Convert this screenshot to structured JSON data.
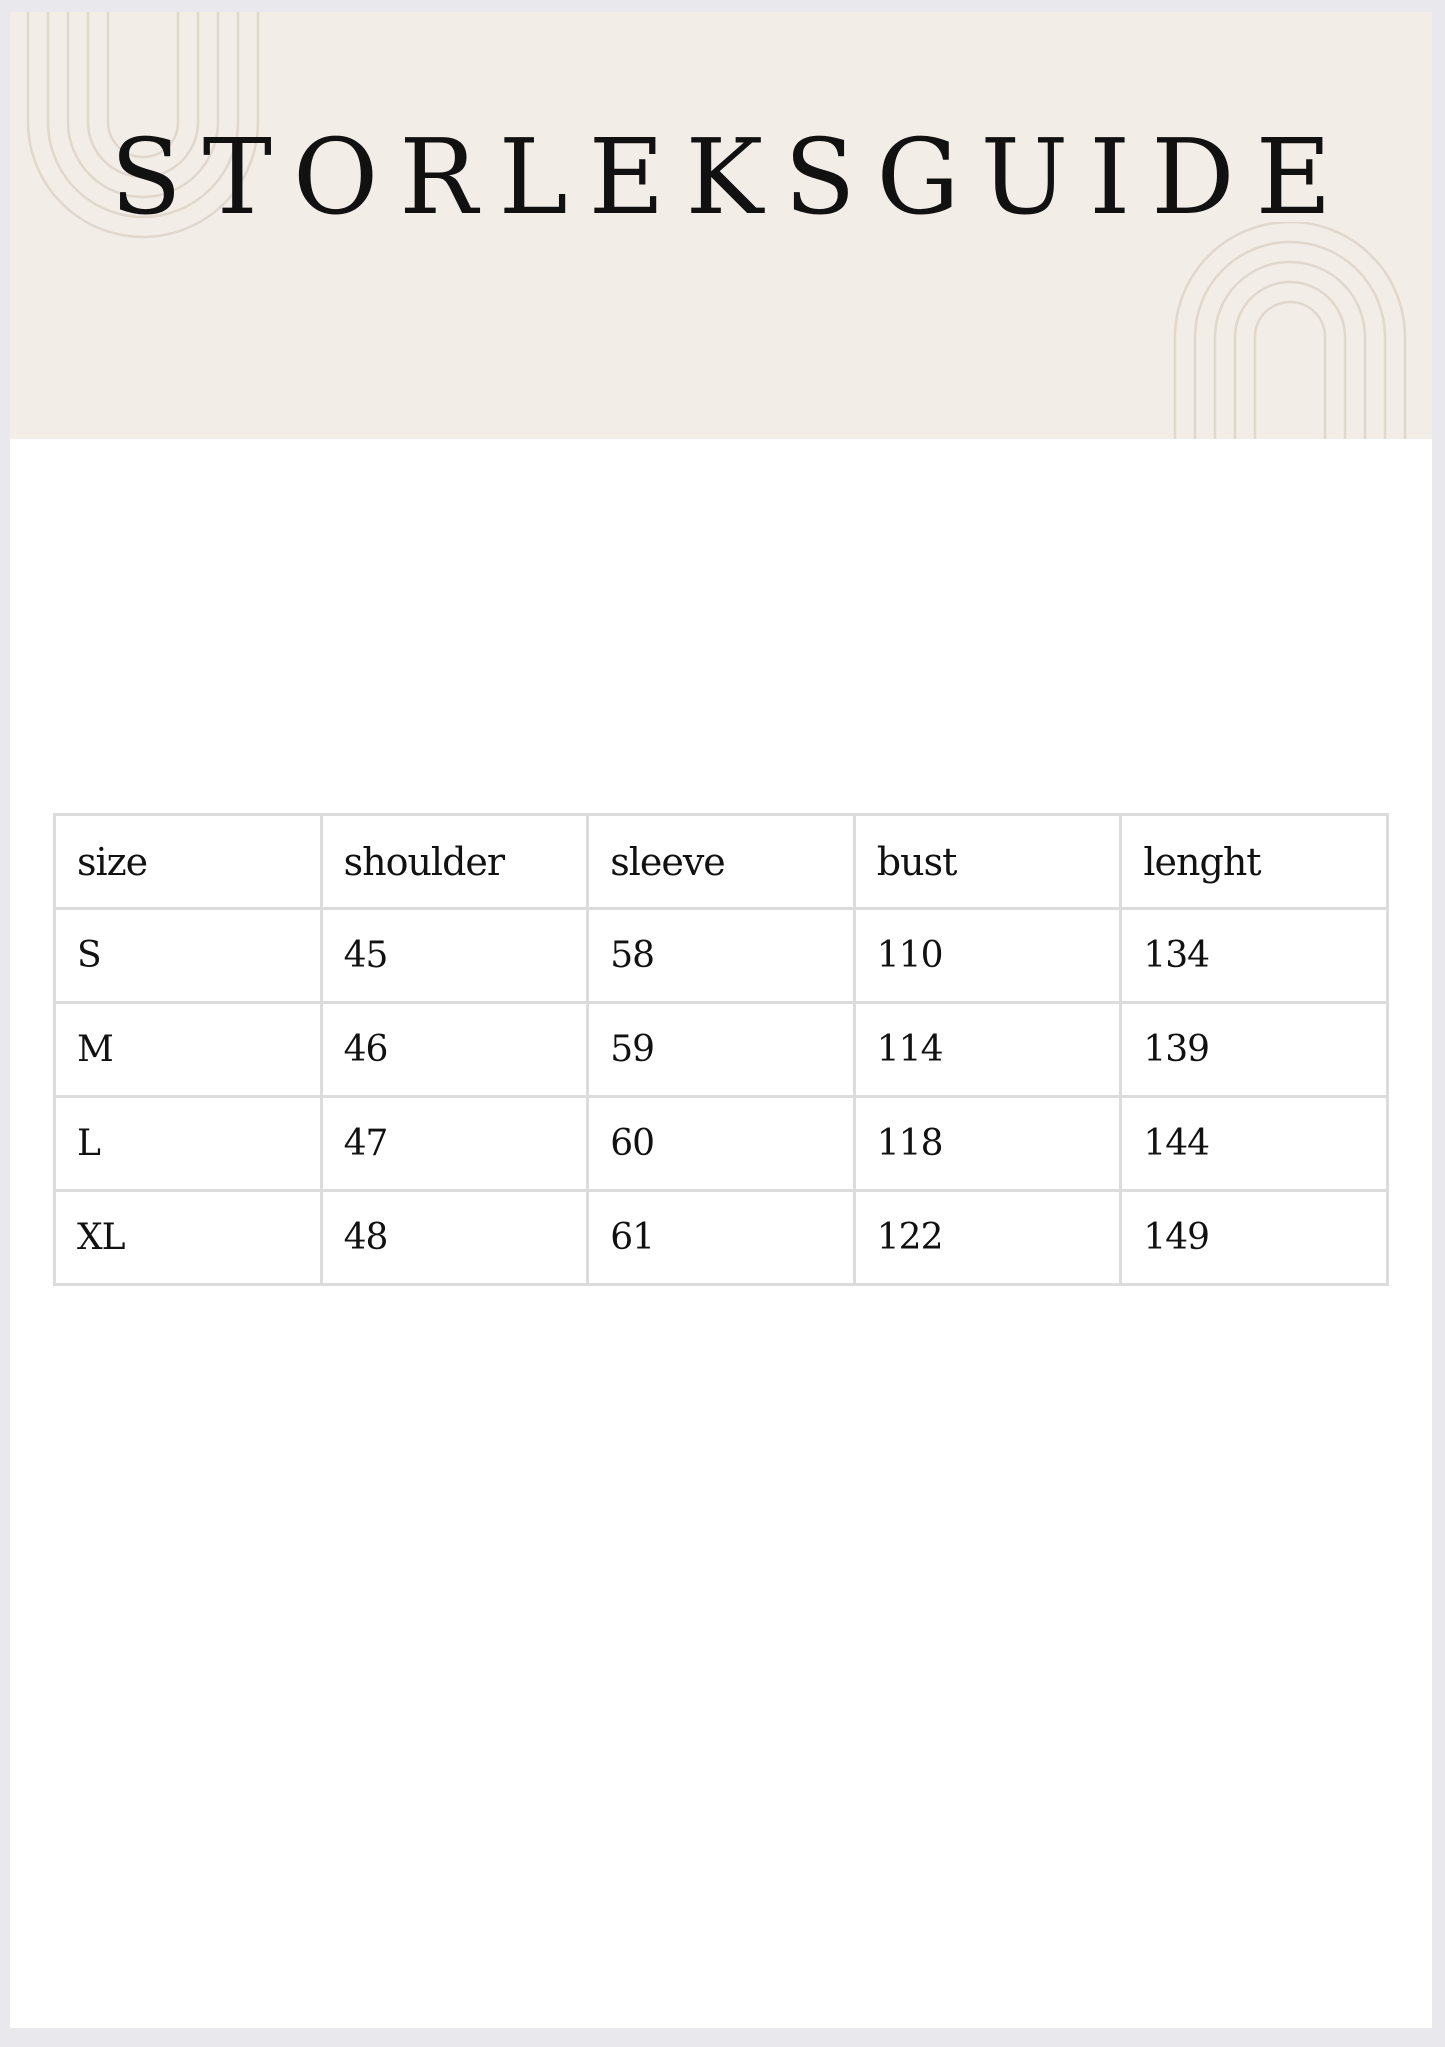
{
  "document": {
    "title": "STORLEKSGUIDE"
  },
  "colors": {
    "header_background": "#f3ede8",
    "arch_lines": "#e0d7cd",
    "text": "#111111",
    "table_border": "#dcdcdc"
  },
  "table": {
    "headers": [
      "size",
      "shoulder",
      "sleeve",
      "bust",
      "lenght"
    ],
    "rows": [
      [
        "S",
        "45",
        "58",
        "110",
        "134"
      ],
      [
        "M",
        "46",
        "59",
        "114",
        "139"
      ],
      [
        "L",
        "47",
        "60",
        "118",
        "144"
      ],
      [
        "XL",
        "48",
        "61",
        "122",
        "149"
      ]
    ]
  }
}
